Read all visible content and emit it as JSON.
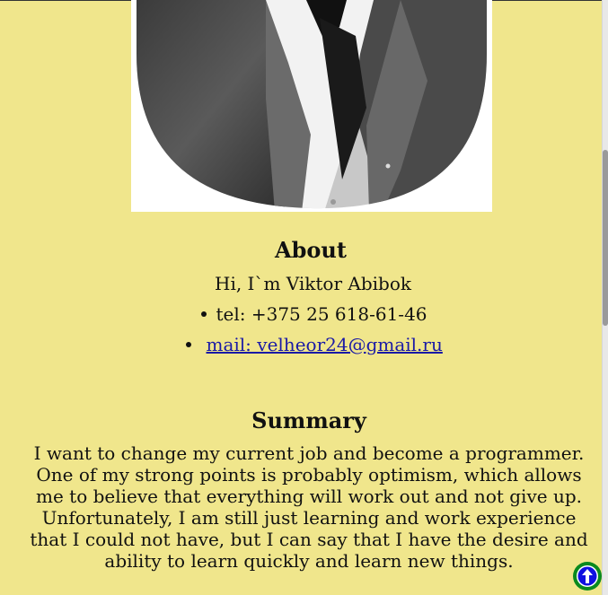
{
  "about": {
    "title": "About",
    "greeting": "Hi, I`m Viktor Abibok",
    "contacts": [
      {
        "text": "tel: +375 25 618-61-46",
        "link": false
      },
      {
        "text": "mail: velheor24@gmail.ru",
        "link": true
      }
    ]
  },
  "summary": {
    "title": "Summary",
    "text": "I want to change my current job and become a programmer. One of my strong points is probably optimism, which allows me to believe that everything will work out and not give up. Unfortunately, I am still just learning and work experience that I could not have, but I can say that I have the desire and ability to learn quickly and learn new things."
  },
  "colors": {
    "background": "#f0e68c",
    "link": "#1a1aa6",
    "scroll_button_ring": "#0a8a1e",
    "scroll_button_fill": "#1010e0"
  },
  "icons": {
    "scroll_top": "arrow-up-icon"
  }
}
